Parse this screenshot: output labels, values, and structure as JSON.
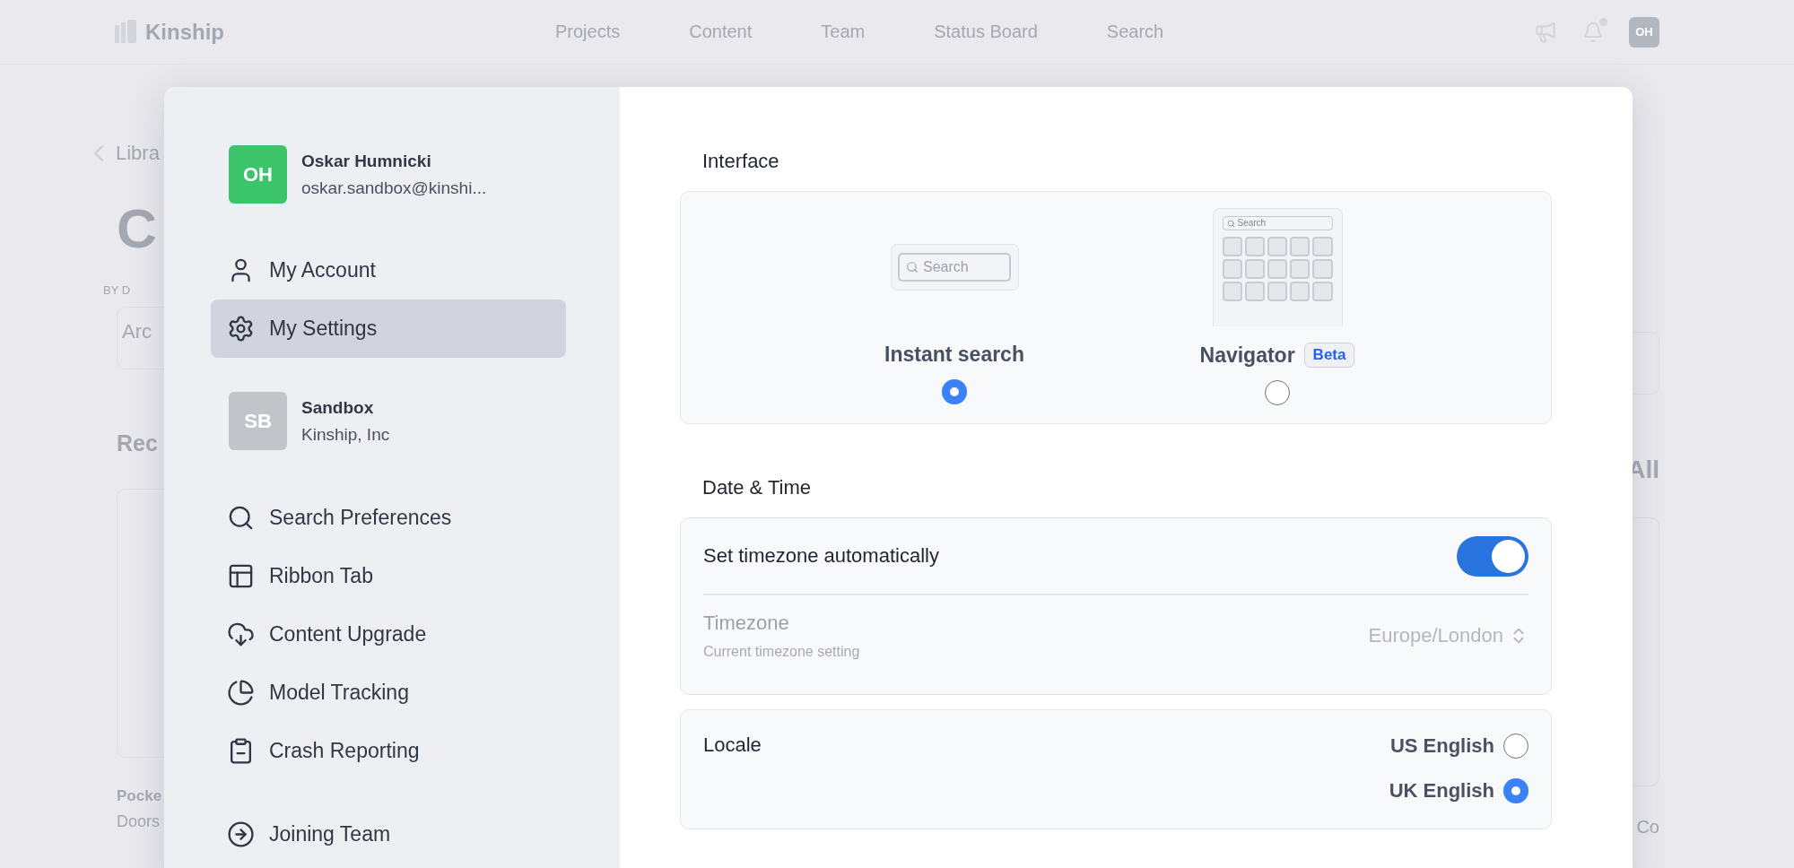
{
  "background": {
    "logo": "Kinship",
    "nav": [
      "Projects",
      "Content",
      "Team",
      "Status Board",
      "Search"
    ],
    "avatar": "OH",
    "left_column": {
      "breadcrumb": "Libra",
      "title": "C",
      "byline": "BY D",
      "field": "Arc",
      "section": "Rec",
      "card_title": "Pocke",
      "card_subtitle": "Doors"
    },
    "right_column": {
      "link": "All",
      "card_title": "Co"
    }
  },
  "sidebar": {
    "user": {
      "initials": "OH",
      "name": "Oskar Humnicki",
      "email": "oskar.sandbox@kinshi..."
    },
    "account_menu": [
      {
        "label": "My Account",
        "selected": false
      },
      {
        "label": "My Settings",
        "selected": true
      }
    ],
    "workspace": {
      "initials": "SB",
      "name": "Sandbox",
      "company": "Kinship, Inc"
    },
    "tools_menu": [
      {
        "label": "Search Preferences",
        "selected": false
      },
      {
        "label": "Ribbon Tab",
        "selected": false
      },
      {
        "label": "Content Upgrade",
        "selected": false
      },
      {
        "label": "Model Tracking",
        "selected": false
      },
      {
        "label": "Crash Reporting",
        "selected": false
      }
    ],
    "team_menu": [
      {
        "label": "Joining Team",
        "selected": false
      }
    ]
  },
  "interface": {
    "title": "Interface",
    "options": [
      {
        "kind": "search",
        "preview_text": "Search",
        "label": "Instant search",
        "selected": true
      },
      {
        "kind": "grid",
        "preview_text": "Search",
        "label": "Navigator",
        "badge": "Beta",
        "selected": false
      }
    ]
  },
  "date_time": {
    "title": "Date & Time",
    "auto_timezone": {
      "label": "Set timezone automatically",
      "on": true
    },
    "timezone": {
      "label": "Timezone",
      "description": "Current timezone setting",
      "value": "Europe/London",
      "disabled": true
    }
  },
  "locale": {
    "label": "Locale",
    "options": [
      {
        "label": "US English",
        "selected": false
      },
      {
        "label": "UK English",
        "selected": true
      }
    ]
  }
}
